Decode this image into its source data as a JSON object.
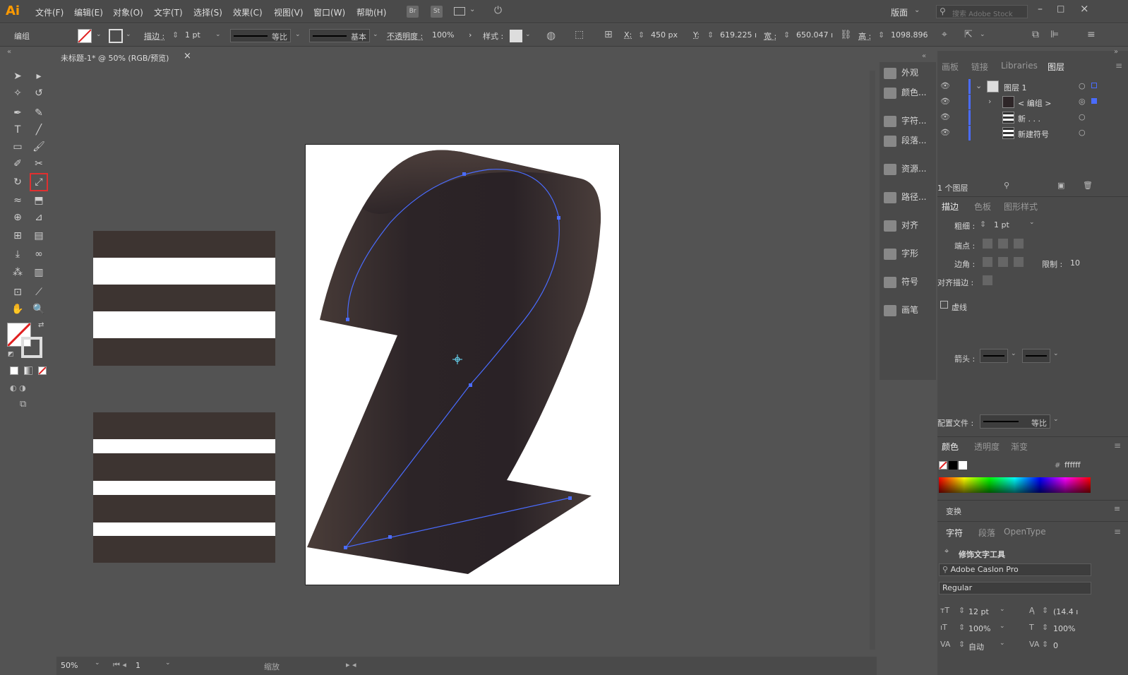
{
  "app": {
    "logo": "Ai",
    "workspace": "版面",
    "search_placeholder": "搜索 Adobe Stock"
  },
  "menu": [
    "文件(F)",
    "编辑(E)",
    "对象(O)",
    "文字(T)",
    "选择(S)",
    "效果(C)",
    "视图(V)",
    "窗口(W)",
    "帮助(H)"
  ],
  "bridge_buttons": [
    "Br",
    "St"
  ],
  "control": {
    "mode_label": "编组",
    "stroke_label": "描边 :",
    "stroke_value": "1 pt",
    "profile_label": "等比",
    "brush_label": "基本",
    "opacity_label": "不透明度 :",
    "opacity_value": "100%",
    "style_label": "样式 :",
    "x_label": "X:",
    "x_value": "450 px",
    "y_label": "Y:",
    "y_value": "619.225 ı",
    "w_label": "宽 :",
    "w_value": "650.047 ı",
    "h_label": "高 :",
    "h_value": "1098.896"
  },
  "doc_tab": {
    "title": "未标题-1* @ 50% (RGB/预览)",
    "close": "×"
  },
  "status": {
    "zoom": "50%",
    "page": "1",
    "mode": "缩放"
  },
  "icon_panel": [
    "外观",
    "颜色...",
    "字符...",
    "段落...",
    "资源...",
    "路径...",
    "对齐",
    "字形",
    "符号",
    "画笔"
  ],
  "layers_panel": {
    "tabs": [
      "画板",
      "链接",
      "Libraries",
      "图层"
    ],
    "active_tab": "图层",
    "rows": [
      {
        "name": "图层 1"
      },
      {
        "name": "< 编组 >"
      },
      {
        "name": "新 . . ."
      },
      {
        "name": "新建符号"
      }
    ],
    "footer": "1 个图层"
  },
  "stroke_panel": {
    "tabs": [
      "描边",
      "色板",
      "图形样式"
    ],
    "weight_label": "粗细 :",
    "weight_value": "1 pt",
    "cap_label": "端点 :",
    "corner_label": "边角 :",
    "limit_label": "限制 :",
    "limit_value": "10",
    "align_label": "对齐描边 :",
    "dashed_label": "虚线",
    "arrow_label": "箭头 :",
    "profile_label": "配置文件 :",
    "profile_value": "等比"
  },
  "color_panel": {
    "tabs": [
      "颜色",
      "透明度",
      "渐变"
    ],
    "hex": "ffffff"
  },
  "transform_panel": {
    "title": "变换"
  },
  "character_panel": {
    "tabs": [
      "字符",
      "段落",
      "OpenType"
    ],
    "touch_tool": "修饰文字工具",
    "font": "Adobe Caslon Pro",
    "style": "Regular",
    "size": "12 pt",
    "leading": "(14.4 ı",
    "vscale": "100%",
    "hscale": "100%",
    "kerning": "自动",
    "tracking": "0"
  },
  "colors": {
    "ui_bg": "#535353",
    "panel_bg": "#4a4a4a",
    "stripe_dark": "#3d3431",
    "shape_dark": "#2e2628",
    "path_blue": "#4a6cff",
    "selected_tool_border": "#e03030"
  }
}
